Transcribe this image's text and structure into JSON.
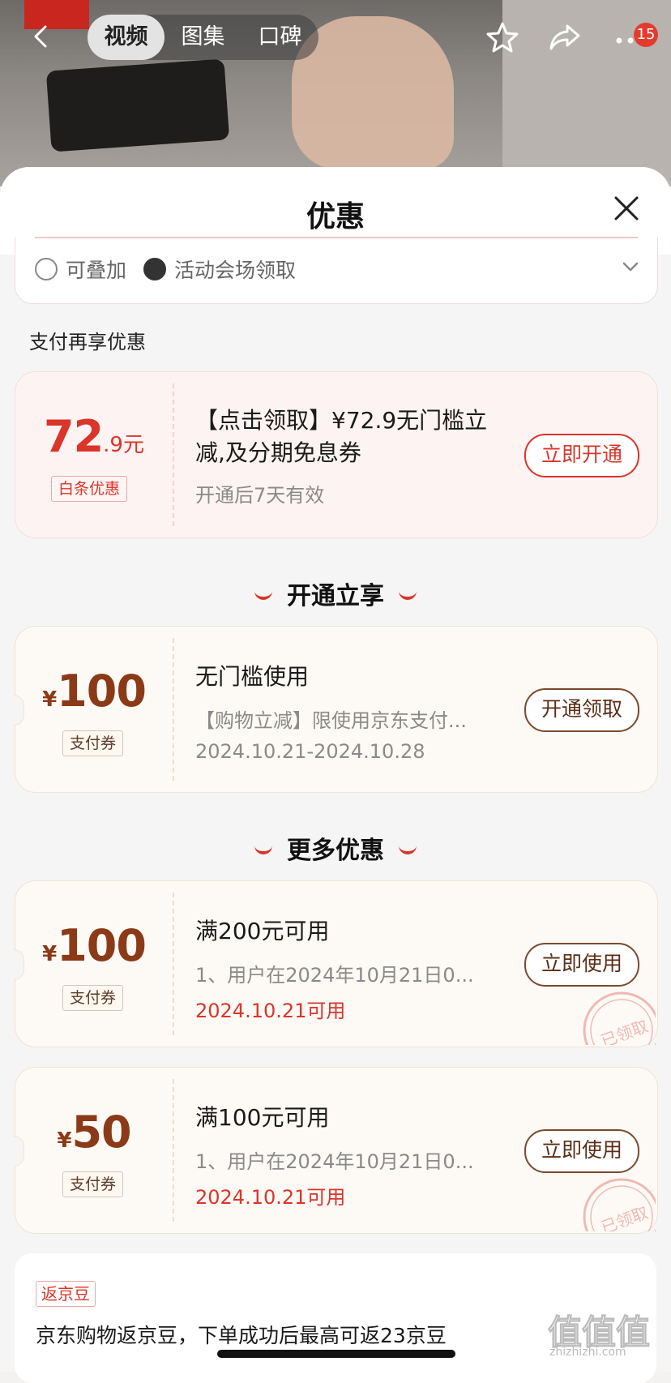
{
  "topbar": {
    "tabs": [
      "视频",
      "图集",
      "口碑"
    ],
    "active_tab": "视频",
    "badge": "15"
  },
  "sheet": {
    "title": "优惠",
    "prev_chips": [
      "可叠加",
      "活动会场领取"
    ],
    "section_label": "支付再享优惠"
  },
  "baitiao": {
    "amount_int": "72",
    "amount_dec": ".9元",
    "tag": "白条优惠",
    "title": "【点击领取】¥72.9无门槛立减,及分期免息券",
    "validity": "开通后7天有效",
    "button": "立即开通"
  },
  "open_section": {
    "title": "开通立享"
  },
  "open_coupon": {
    "symbol": "¥",
    "amount": "100",
    "tag": "支付券",
    "title": "无门槛使用",
    "desc": "【购物立减】限使用京东支付...",
    "dates": "2024.10.21-2024.10.28",
    "button": "开通领取"
  },
  "more_section": {
    "title": "更多优惠"
  },
  "more_coupons": [
    {
      "symbol": "¥",
      "amount": "100",
      "tag": "支付券",
      "title": "满200元可用",
      "desc": "1、用户在2024年10月21日0...",
      "date": "2024.10.21可用",
      "button": "立即使用",
      "stamp": "已领取"
    },
    {
      "symbol": "¥",
      "amount": "50",
      "tag": "支付券",
      "title": "满100元可用",
      "desc": "1、用户在2024年10月21日0...",
      "date": "2024.10.21可用",
      "button": "立即使用",
      "stamp": "已领取"
    }
  ],
  "bean": {
    "tag": "返京豆",
    "text": "京东购物返京豆，下单成功后最高可返23京豆"
  },
  "watermark": {
    "main": "值值值",
    "sub": "zhizhizhi.com"
  },
  "colors": {
    "accent_red": "#d9352a",
    "brown": "#8b3a18"
  }
}
